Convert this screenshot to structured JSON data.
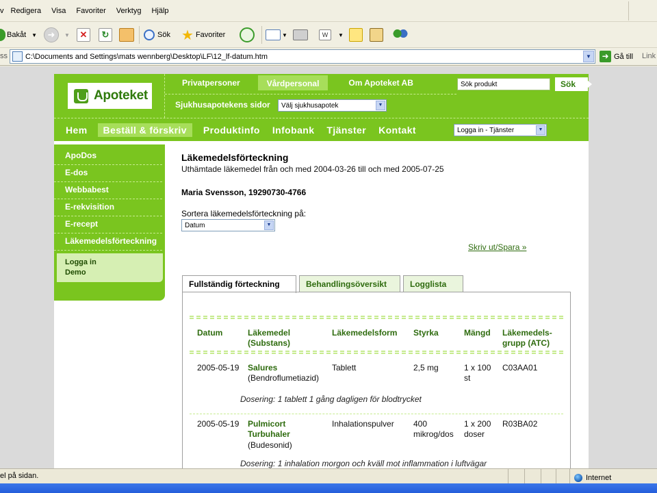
{
  "browser": {
    "menu": [
      "v",
      "Redigera",
      "Visa",
      "Favoriter",
      "Verktyg",
      "Hjälp"
    ],
    "toolbar": {
      "back_label": "Bakåt",
      "search_label": "Sök",
      "favorites_label": "Favoriter"
    },
    "address": {
      "label": "ss",
      "url": "C:\\Documents and Settings\\mats wennberg\\Desktop\\LF\\12_lf-datum.htm",
      "go_label": "Gå till",
      "links_label": "Link"
    },
    "status": {
      "message": "el på sidan.",
      "zone": "Internet"
    }
  },
  "site": {
    "logo": "Apoteket",
    "top_tabs": [
      "Privatpersoner",
      "Vårdpersonal",
      "Om Apoteket AB"
    ],
    "search_placeholder": "Sök produkt",
    "search_button": "Sök",
    "sjukhus_label": "Sjukhusapotekens sidor",
    "sjukhus_select": "Välj sjukhusapotek",
    "main_nav": [
      "Hem",
      "Beställ & förskriv",
      "Produktinfo",
      "Infobank",
      "Tjänster",
      "Kontakt"
    ],
    "login_select": "Logga in - Tjänster",
    "side_nav": [
      "ApoDos",
      "E-dos",
      "Webbabest",
      "E-rekvisition",
      "E-recept",
      "Läkemedelsförteckning"
    ],
    "side_box": [
      "Logga in",
      "Demo"
    ]
  },
  "content": {
    "title": "Läkemedelsförteckning",
    "subtitle": "Uthämtade läkemedel från och med 2004-03-26 till och med 2005-07-25",
    "patient": "Maria Svensson, 19290730-4766",
    "sort_label": "Sortera läkemedelsförteckning på:",
    "sort_value": "Datum",
    "print_link": "Skriv ut/Spara »",
    "tabs": [
      "Fullständig förteckning",
      "Behandlingsöversikt",
      "Logglista"
    ],
    "table": {
      "headers": {
        "date": "Datum",
        "drug": [
          "Läkemedel",
          "(Substans)"
        ],
        "form": "Läkemedelsform",
        "strength": "Styrka",
        "amount": "Mängd",
        "atc": [
          "Läkemedels-",
          "grupp (ATC)"
        ]
      },
      "rows": [
        {
          "date": "2005-05-19",
          "drug": [
            "Salures"
          ],
          "substance": "(Bendroflumetiazid)",
          "form": "Tablett",
          "strength": [
            "2,5 mg"
          ],
          "amount": [
            "1 x 100",
            "st"
          ],
          "atc": "C03AA01",
          "dosing": "Dosering:  1 tablett 1 gång dagligen för blodtrycket"
        },
        {
          "date": "2005-05-19",
          "drug": [
            "Pulmicort",
            "Turbuhaler"
          ],
          "substance": "(Budesonid)",
          "form": "Inhalationspulver",
          "strength": [
            "400",
            "mikrog/dos"
          ],
          "amount": [
            "1 x 200",
            "doser"
          ],
          "atc": "R03BA02",
          "dosing": "Dosering:  1 inhalation morgon och kväll mot inflammation i luftvägar"
        }
      ]
    }
  }
}
